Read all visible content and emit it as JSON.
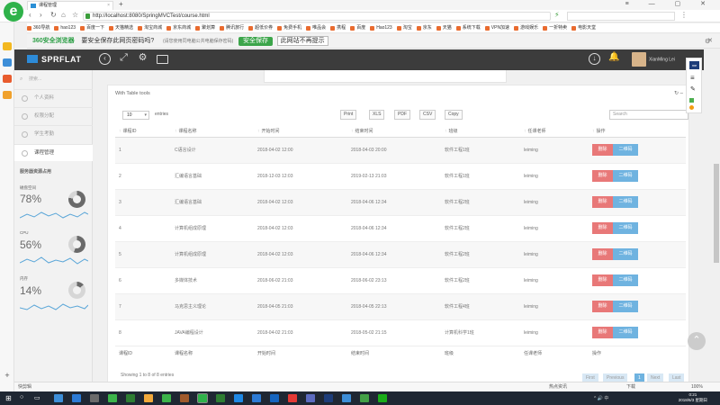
{
  "browser": {
    "tab_title": "课程管理",
    "new_tab": "+",
    "window_controls": "≡ — ▢ ✕",
    "url": "http://localhost:8080/SpringMVCTest/course.html",
    "bookmarks": [
      "360导航",
      "hao123",
      "百度一下",
      "天猫精选",
      "淘宝商城",
      "京东商城",
      "聚划算",
      "腾讯旅行",
      "超低价券",
      "免费手机",
      "唯品会",
      "携程",
      "百度",
      "Hao123",
      "淘宝",
      "京东",
      "天猫",
      "系统下载",
      "VPN加速",
      "游戏娱乐",
      "一折特卖",
      "电影天堂"
    ],
    "notice": {
      "brand": "360安全浏览器",
      "question": "要安全保存此网页密码吗?",
      "hint": "(请您使用同电脑公共电脑保存密码)",
      "save_button": "安全保存",
      "dismiss_button": "此网站不再提示"
    }
  },
  "header": {
    "brand": "SPRFLAT",
    "user_name": "XianMing Lei"
  },
  "sidebar": {
    "search_placeholder": "搜索...",
    "items": [
      {
        "label": "个人资料"
      },
      {
        "label": "权限分配"
      },
      {
        "label": "学生考勤"
      },
      {
        "label": "课程管理"
      }
    ],
    "resources_title": "服务器资源占用",
    "metrics": [
      {
        "label": "磁盘空间",
        "value": "78%",
        "fraction": 0.78
      },
      {
        "label": "CPU",
        "value": "56%",
        "fraction": 0.56
      },
      {
        "label": "内存",
        "value": "14%",
        "fraction": 0.14
      }
    ]
  },
  "panel": {
    "title": "With Table tools",
    "tools": "↻ –",
    "length_value": "10",
    "length_label": "entries",
    "export_buttons": [
      "Print",
      "XLS",
      "PDF",
      "CSV",
      "Copy"
    ],
    "search_placeholder": "Search",
    "columns": [
      "课程ID",
      "课程名称",
      "开始时间",
      "结束时间",
      "班级",
      "任课老师",
      "操作"
    ],
    "rows": [
      {
        "id": "1",
        "name": "C语言设计",
        "start": "2018-04-02 12:00",
        "end": "2018-04-03 20:00",
        "cls": "软件工程1班",
        "teacher": "leiming"
      },
      {
        "id": "2",
        "name": "汇编语言基础",
        "start": "2018-12-03 12:03",
        "end": "2019-02-13 21:03",
        "cls": "软件工程1班",
        "teacher": "leiming"
      },
      {
        "id": "3",
        "name": "汇编语言基础",
        "start": "2018-04-02 12:03",
        "end": "2018-04-06 12:34",
        "cls": "软件工程2班",
        "teacher": "leiming"
      },
      {
        "id": "4",
        "name": "计算机组成原理",
        "start": "2018-04-02 12:03",
        "end": "2018-04-06 12:34",
        "cls": "软件工程2班",
        "teacher": "leiming"
      },
      {
        "id": "5",
        "name": "计算机组成原理",
        "start": "2018-04-02 12:03",
        "end": "2018-04-06 12:34",
        "cls": "软件工程2班",
        "teacher": "leiming"
      },
      {
        "id": "6",
        "name": "多媒体技术",
        "start": "2018-06-02 21:03",
        "end": "2018-06-02 23:13",
        "cls": "软件工程2班",
        "teacher": "leiming"
      },
      {
        "id": "7",
        "name": "马克思主义理论",
        "start": "2018-04-05 21:03",
        "end": "2018-04-05 22:13",
        "cls": "软件工程4班",
        "teacher": "leiming"
      },
      {
        "id": "8",
        "name": "JAVA编程设计",
        "start": "2018-04-02 21:03",
        "end": "2018-05-02 21:15",
        "cls": "计算机科学1班",
        "teacher": "leiming"
      }
    ],
    "delete_label": "删除",
    "qr_label": "二维码",
    "info": "Showing 1 to 8 of 8 entries",
    "pager": [
      "First",
      "Previous",
      "1",
      "Next",
      "Last"
    ]
  },
  "statusbar": {
    "left": "快剪辑",
    "right": [
      "热点资讯",
      "下载",
      "100%"
    ]
  },
  "taskbar": {
    "time": "0:21",
    "date": "2018/6/3 星期日",
    "tray": "^ 🔊 中"
  },
  "colors": {
    "delete": "#e87878",
    "qr": "#6fb3e0",
    "header_bg": "#3c3c3c",
    "brand_green": "#2fa048"
  }
}
